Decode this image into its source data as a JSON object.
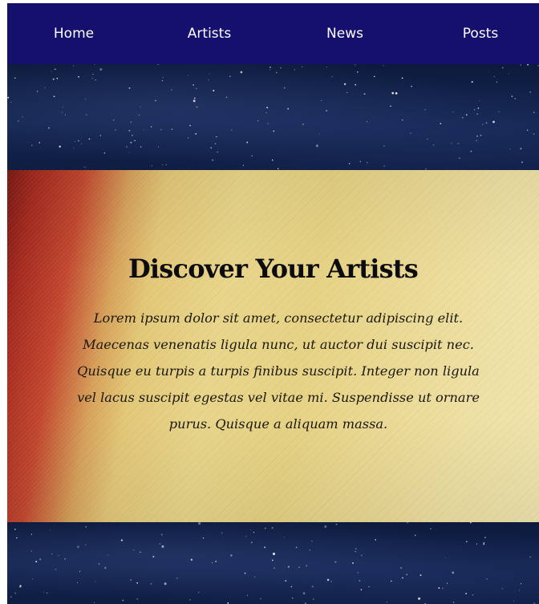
{
  "nav": {
    "items": [
      {
        "label": "Home"
      },
      {
        "label": "Artists"
      },
      {
        "label": "News"
      },
      {
        "label": "Posts"
      }
    ]
  },
  "hero": {
    "title": "Discover Your Artists",
    "body": "Lorem ipsum dolor sit amet, consectetur adipiscing elit. Maecenas venenatis ligula nunc, ut auctor dui suscipit nec. Quisque eu turpis a turpis finibus suscipit. Integer non ligula vel lacus suscipit egestas vel vitae mi. Suspendisse ut ornare purus. Quisque a aliquam massa."
  },
  "colors": {
    "nav_background": "#150f6e",
    "nav_text": "#ffffff",
    "space_background": "#0d1a3d",
    "hero_red": "#a5291f",
    "hero_gold": "#e6d283"
  }
}
